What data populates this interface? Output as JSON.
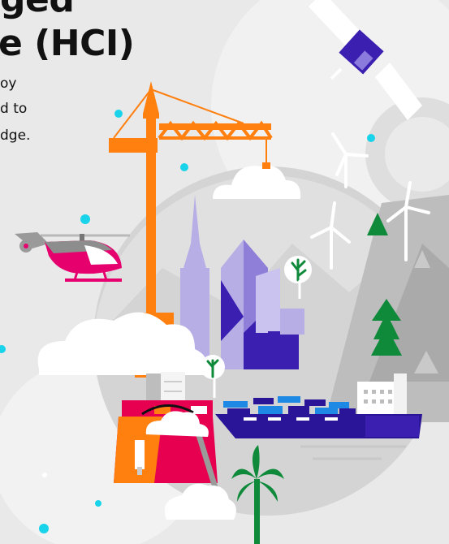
{
  "heading": {
    "line1": "ged",
    "line2": "e (HCI)"
  },
  "body": {
    "line1": "oy",
    "line2": "d to",
    "line3": "dge."
  },
  "colors": {
    "background": "#e9e9e9",
    "crane": "#ff7f0f",
    "buildings_light": "#b8aee6",
    "buildings_dark": "#3a1fb0",
    "ship_hull": "#2a1599",
    "ship_stripes": "#1e88e5",
    "helicopter": "#e6006e",
    "trees": "#0f8a3a",
    "toolbox": "#e6004f",
    "accent_dots": "#19d3ea"
  },
  "icons": {
    "satellite": "satellite-icon",
    "crane": "construction-crane-icon",
    "helicopter": "helicopter-icon",
    "wind_turbine": "wind-turbine-icon",
    "cargo_ship": "cargo-ship-icon",
    "toolbox": "toolbox-icon",
    "palm_tree": "palm-tree-icon"
  }
}
